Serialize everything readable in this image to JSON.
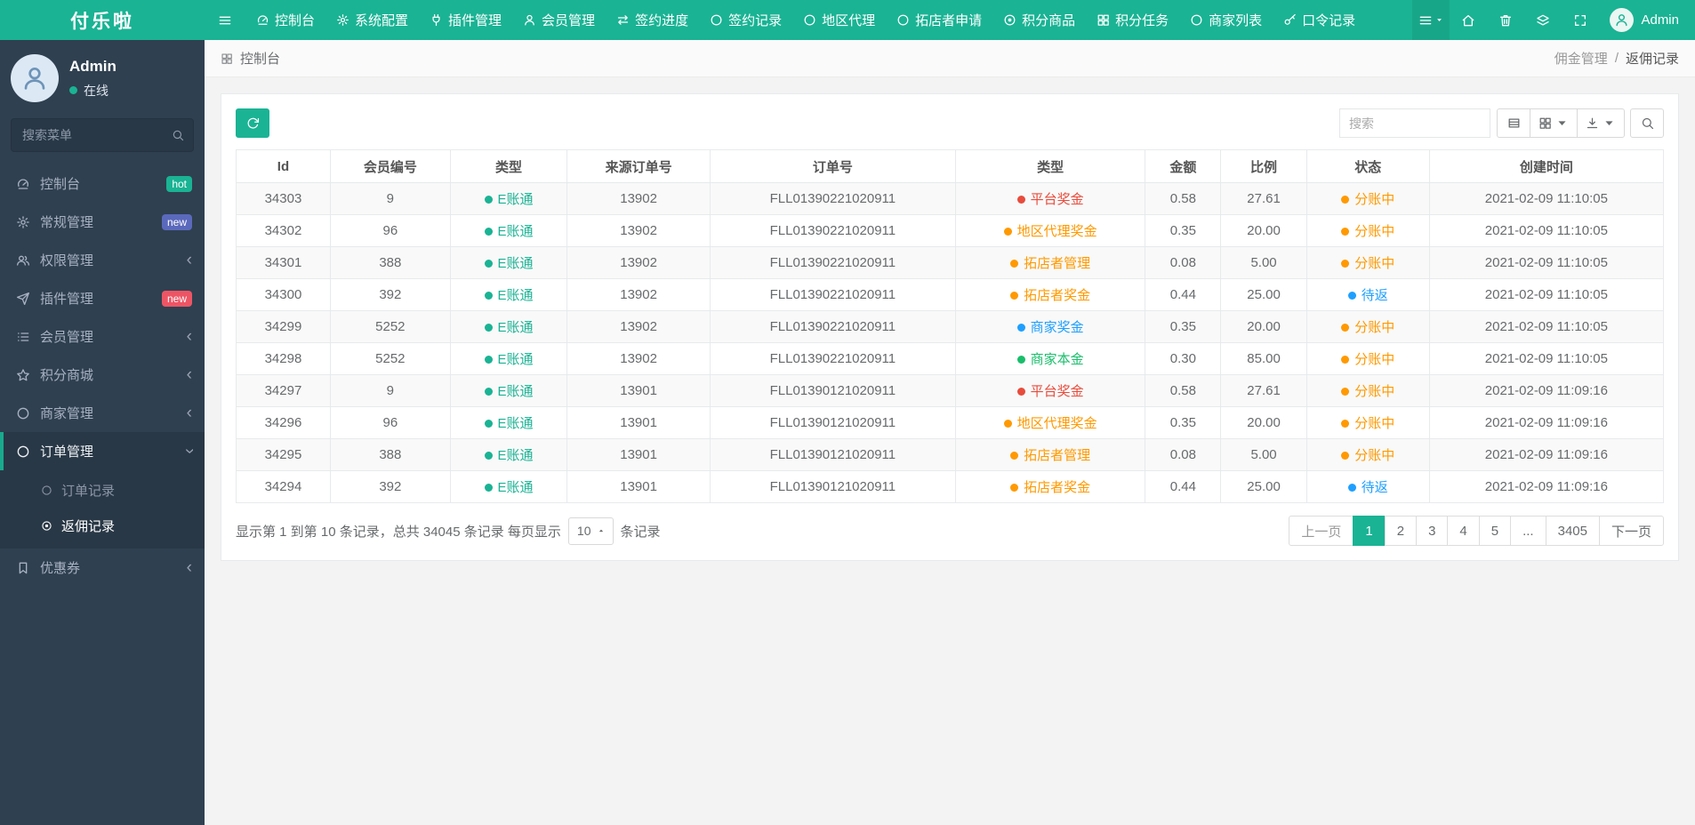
{
  "colors": {
    "teal": "#1ab394",
    "green": "#19be6b",
    "orange": "#ff9900",
    "red": "#e74c3c",
    "blue": "#1e9fff"
  },
  "brand": {
    "title": "付乐啦"
  },
  "navbar": {
    "items": [
      {
        "label": "控制台",
        "icon": "gauge"
      },
      {
        "label": "系统配置",
        "icon": "gear"
      },
      {
        "label": "插件管理",
        "icon": "plug"
      },
      {
        "label": "会员管理",
        "icon": "user"
      },
      {
        "label": "签约进度",
        "icon": "exchange"
      },
      {
        "label": "签约记录",
        "icon": "circle"
      },
      {
        "label": "地区代理",
        "icon": "circle"
      },
      {
        "label": "拓店者申请",
        "icon": "circle"
      },
      {
        "label": "积分商品",
        "icon": "circle-dot"
      },
      {
        "label": "积分任务",
        "icon": "th"
      },
      {
        "label": "商家列表",
        "icon": "circle"
      },
      {
        "label": "口令记录",
        "icon": "key"
      }
    ],
    "right_buttons": [
      {
        "icon": "menu",
        "caret": true,
        "active": true
      },
      {
        "icon": "home"
      },
      {
        "icon": "trash"
      },
      {
        "icon": "layers"
      },
      {
        "icon": "expand"
      }
    ],
    "user_name": "Admin"
  },
  "sidebar": {
    "profile": {
      "name": "Admin",
      "status": "在线"
    },
    "search_placeholder": "搜索菜单",
    "items": [
      {
        "label": "控制台",
        "icon": "gauge",
        "badge": {
          "text": "hot",
          "color": "#1ab394"
        }
      },
      {
        "label": "常规管理",
        "icon": "gear",
        "badge": {
          "text": "new",
          "color": "#5b69bc"
        }
      },
      {
        "label": "权限管理",
        "icon": "users",
        "chevron": true
      },
      {
        "label": "插件管理",
        "icon": "plane",
        "badge": {
          "text": "new",
          "color": "#ed5565"
        }
      },
      {
        "label": "会员管理",
        "icon": "list",
        "chevron": true
      },
      {
        "label": "积分商城",
        "icon": "star",
        "chevron": true
      },
      {
        "label": "商家管理",
        "icon": "circle",
        "chevron": true
      },
      {
        "label": "订单管理",
        "icon": "circle",
        "chevron": true,
        "expanded": true,
        "children": [
          {
            "label": "订单记录",
            "icon": "circle"
          },
          {
            "label": "返佣记录",
            "icon": "circle-dot",
            "active": true
          }
        ]
      },
      {
        "label": "优惠券",
        "icon": "bookmark",
        "chevron": true
      }
    ]
  },
  "breadcrumb": {
    "title": "控制台",
    "section": "佣金管理",
    "separator": "/",
    "current": "返佣记录"
  },
  "toolbar": {
    "search_placeholder": "搜索",
    "view_buttons": [
      {
        "icon": "table",
        "caret": false
      },
      {
        "icon": "th",
        "caret": true
      },
      {
        "icon": "download",
        "caret": true
      }
    ]
  },
  "table": {
    "columns": [
      "Id",
      "会员编号",
      "类型",
      "来源订单号",
      "订单号",
      "类型",
      "金额",
      "比例",
      "状态",
      "创建时间"
    ],
    "rows": [
      {
        "id": "34303",
        "member_no": "9",
        "account_type": {
          "label": "E账通",
          "color": "teal"
        },
        "source_order": "13902",
        "order_no": "FLL01390221020911",
        "bonus_type": {
          "label": "平台奖金",
          "color": "red"
        },
        "amount": "0.58",
        "ratio": "27.61",
        "status": {
          "label": "分账中",
          "color": "orange"
        },
        "created_at": "2021-02-09 11:10:05"
      },
      {
        "id": "34302",
        "member_no": "96",
        "account_type": {
          "label": "E账通",
          "color": "teal"
        },
        "source_order": "13902",
        "order_no": "FLL01390221020911",
        "bonus_type": {
          "label": "地区代理奖金",
          "color": "orange"
        },
        "amount": "0.35",
        "ratio": "20.00",
        "status": {
          "label": "分账中",
          "color": "orange"
        },
        "created_at": "2021-02-09 11:10:05"
      },
      {
        "id": "34301",
        "member_no": "388",
        "account_type": {
          "label": "E账通",
          "color": "teal"
        },
        "source_order": "13902",
        "order_no": "FLL01390221020911",
        "bonus_type": {
          "label": "拓店者管理",
          "color": "orange"
        },
        "amount": "0.08",
        "ratio": "5.00",
        "status": {
          "label": "分账中",
          "color": "orange"
        },
        "created_at": "2021-02-09 11:10:05"
      },
      {
        "id": "34300",
        "member_no": "392",
        "account_type": {
          "label": "E账通",
          "color": "teal"
        },
        "source_order": "13902",
        "order_no": "FLL01390221020911",
        "bonus_type": {
          "label": "拓店者奖金",
          "color": "orange"
        },
        "amount": "0.44",
        "ratio": "25.00",
        "status": {
          "label": "待返",
          "color": "blue"
        },
        "created_at": "2021-02-09 11:10:05"
      },
      {
        "id": "34299",
        "member_no": "5252",
        "account_type": {
          "label": "E账通",
          "color": "teal"
        },
        "source_order": "13902",
        "order_no": "FLL01390221020911",
        "bonus_type": {
          "label": "商家奖金",
          "color": "blue"
        },
        "amount": "0.35",
        "ratio": "20.00",
        "status": {
          "label": "分账中",
          "color": "orange"
        },
        "created_at": "2021-02-09 11:10:05"
      },
      {
        "id": "34298",
        "member_no": "5252",
        "account_type": {
          "label": "E账通",
          "color": "teal"
        },
        "source_order": "13902",
        "order_no": "FLL01390221020911",
        "bonus_type": {
          "label": "商家本金",
          "color": "green"
        },
        "amount": "0.30",
        "ratio": "85.00",
        "status": {
          "label": "分账中",
          "color": "orange"
        },
        "created_at": "2021-02-09 11:10:05"
      },
      {
        "id": "34297",
        "member_no": "9",
        "account_type": {
          "label": "E账通",
          "color": "teal"
        },
        "source_order": "13901",
        "order_no": "FLL01390121020911",
        "bonus_type": {
          "label": "平台奖金",
          "color": "red"
        },
        "amount": "0.58",
        "ratio": "27.61",
        "status": {
          "label": "分账中",
          "color": "orange"
        },
        "created_at": "2021-02-09 11:09:16"
      },
      {
        "id": "34296",
        "member_no": "96",
        "account_type": {
          "label": "E账通",
          "color": "teal"
        },
        "source_order": "13901",
        "order_no": "FLL01390121020911",
        "bonus_type": {
          "label": "地区代理奖金",
          "color": "orange"
        },
        "amount": "0.35",
        "ratio": "20.00",
        "status": {
          "label": "分账中",
          "color": "orange"
        },
        "created_at": "2021-02-09 11:09:16"
      },
      {
        "id": "34295",
        "member_no": "388",
        "account_type": {
          "label": "E账通",
          "color": "teal"
        },
        "source_order": "13901",
        "order_no": "FLL01390121020911",
        "bonus_type": {
          "label": "拓店者管理",
          "color": "orange"
        },
        "amount": "0.08",
        "ratio": "5.00",
        "status": {
          "label": "分账中",
          "color": "orange"
        },
        "created_at": "2021-02-09 11:09:16"
      },
      {
        "id": "34294",
        "member_no": "392",
        "account_type": {
          "label": "E账通",
          "color": "teal"
        },
        "source_order": "13901",
        "order_no": "FLL01390121020911",
        "bonus_type": {
          "label": "拓店者奖金",
          "color": "orange"
        },
        "amount": "0.44",
        "ratio": "25.00",
        "status": {
          "label": "待返",
          "color": "blue"
        },
        "created_at": "2021-02-09 11:09:16"
      }
    ]
  },
  "footer": {
    "summary_prefix": "显示第 1 到第 10 条记录，总共 34045 条记录 每页显示",
    "page_size": "10",
    "summary_suffix": "条记录",
    "pages": [
      "上一页",
      "1",
      "2",
      "3",
      "4",
      "5",
      "...",
      "3405",
      "下一页"
    ],
    "active_page": "1"
  }
}
